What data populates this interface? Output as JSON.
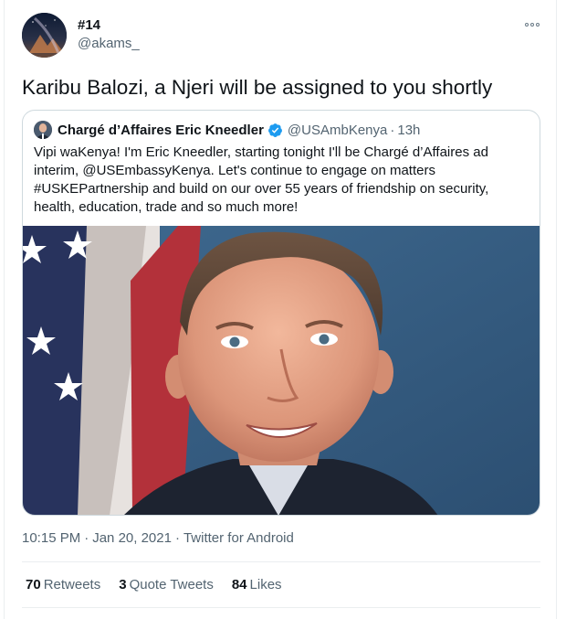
{
  "tweet": {
    "author_name": "#14",
    "author_handle": "@akams_",
    "text": "Karibu Balozi, a Njeri will be assigned to you shortly",
    "time": "10:15 PM",
    "date": "Jan 20, 2021",
    "source": "Twitter for Android",
    "separator": "·"
  },
  "quoted": {
    "name": "Chargé d’Affaires Eric Kneedler",
    "handle": "@USAmbKenya",
    "dot": "·",
    "time_ago": "13h",
    "text": "Vipi waKenya! I'm Eric Kneedler, starting tonight I'll be Chargé d’Affaires ad interim, @USEmbassyKenya. Let's continue to engage on matters #USKEPartnership and build on our over 55 years of friendship on security, health, education, trade and so much more!"
  },
  "stats": {
    "retweets_count": "70",
    "retweets_label": "Retweets",
    "quotes_count": "3",
    "quotes_label": "Quote Tweets",
    "likes_count": "84",
    "likes_label": "Likes"
  },
  "icons": {
    "more": "more-options-icon",
    "verified": "verified-badge-icon"
  },
  "colors": {
    "text": "#0f1419",
    "secondary": "#536471",
    "border": "#cfd9de",
    "verified": "#1d9bf0"
  }
}
